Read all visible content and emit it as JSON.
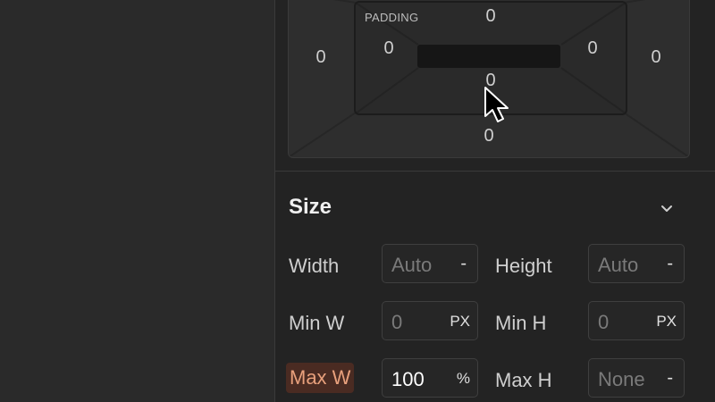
{
  "spacing": {
    "padding_label": "PADDING",
    "padding": {
      "top": "0",
      "left": "0",
      "right": "0",
      "bottom": "0"
    },
    "margin": {
      "left": "0",
      "right": "0",
      "bottom": "0"
    }
  },
  "size": {
    "title": "Size",
    "width": {
      "label": "Width",
      "value": "Auto",
      "unit": "-"
    },
    "height": {
      "label": "Height",
      "value": "Auto",
      "unit": "-"
    },
    "min_w": {
      "label": "Min W",
      "value": "0",
      "unit": "PX"
    },
    "min_h": {
      "label": "Min H",
      "value": "0",
      "unit": "PX"
    },
    "max_w": {
      "label": "Max W",
      "value": "100",
      "unit": "%"
    },
    "max_h": {
      "label": "Max H",
      "value": "None",
      "unit": "-"
    }
  },
  "icons": {
    "collapse": "chevron-down-icon",
    "cursor": "mouse-pointer-icon"
  },
  "colors": {
    "panel_bg": "#232323",
    "highlight_bg": "#4a2b22",
    "highlight_text": "#e8a07c"
  }
}
